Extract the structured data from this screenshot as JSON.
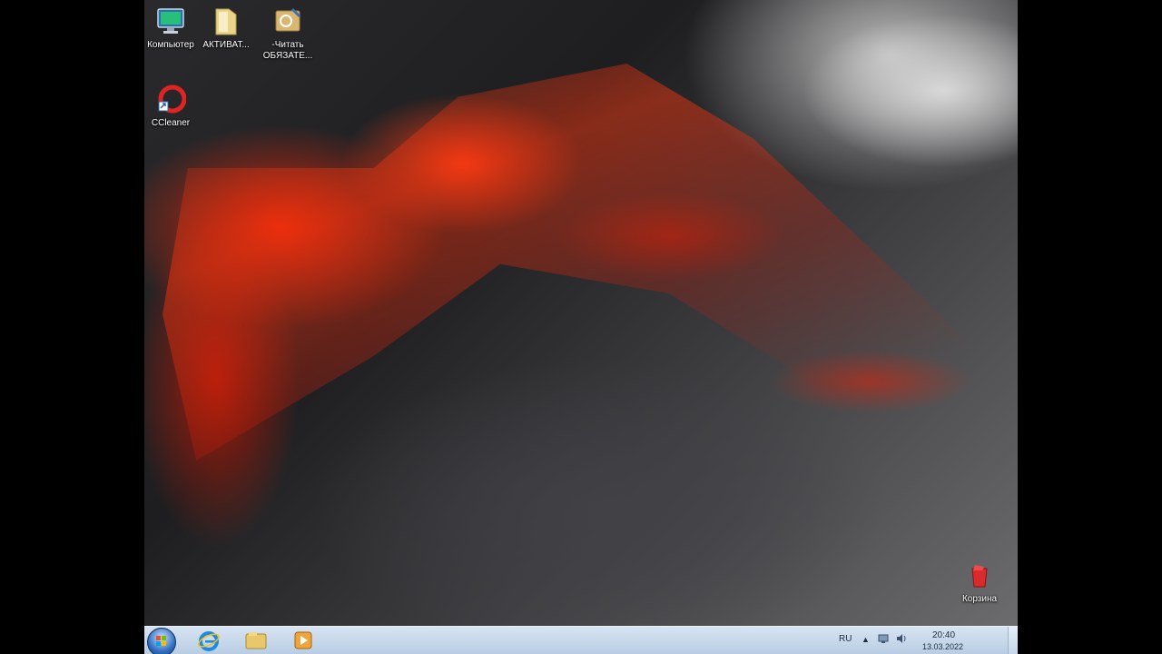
{
  "desktop": {
    "icons": [
      {
        "name": "computer",
        "label": "Компьютер"
      },
      {
        "name": "activator-folder",
        "label": "АКТИВАТ..."
      },
      {
        "name": "readme",
        "label": "-Читать ОБЯЗАТЕ..."
      },
      {
        "name": "ccleaner",
        "label": "CCleaner"
      },
      {
        "name": "recycle-bin",
        "label": "Корзина"
      }
    ]
  },
  "taskbar": {
    "pinned": [
      "start-orb-icon",
      "internet-explorer-icon",
      "explorer-icon",
      "media-player-icon"
    ],
    "tray": {
      "language": "RU",
      "time": "20:40",
      "date": "13.03.2022"
    }
  },
  "colors": {
    "taskbar": "#c9d9eb",
    "lava": "#ff3c14"
  }
}
